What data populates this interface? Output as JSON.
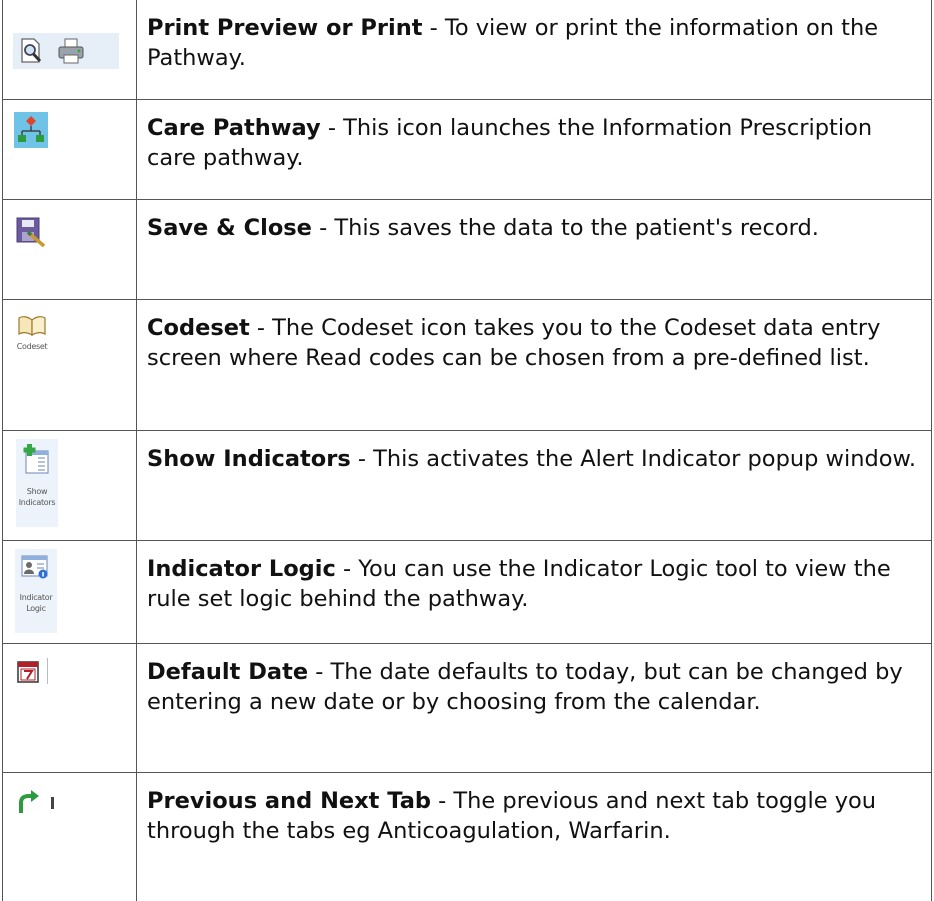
{
  "rows": [
    {
      "icon": [
        "print-preview-icon",
        "printer-icon"
      ],
      "title": "Print Preview or Print",
      "text": " - To view or print the information on the Pathway."
    },
    {
      "icon": [
        "care-pathway-icon"
      ],
      "title": "Care Pathway",
      "text": " - This icon launches the Information Prescription care pathway."
    },
    {
      "icon": [
        "save-close-icon"
      ],
      "title": "Save & Close",
      "text": " - This saves the data to the patient's record."
    },
    {
      "icon": [
        "codeset-icon"
      ],
      "icon_caption": "Codeset",
      "title": "Codeset",
      "text": " - The Codeset icon takes you to the Codeset data entry screen where Read codes can be chosen from a pre-defined list."
    },
    {
      "icon": [
        "show-indicators-icon"
      ],
      "icon_caption": [
        "Show",
        "Indicators"
      ],
      "title": "Show Indicators",
      "text": " - This activates the Alert Indicator popup window."
    },
    {
      "icon": [
        "indicator-logic-icon"
      ],
      "icon_caption": [
        "Indicator",
        "Logic"
      ],
      "title": "Indicator Logic",
      "text": " - You can use the Indicator Logic tool to view the rule set logic behind the pathway."
    },
    {
      "icon": [
        "calendar-icon"
      ],
      "title": "Default Date",
      "text": " - The date defaults to today, but can be changed by entering a new date or by choosing from the calendar."
    },
    {
      "icon": [
        "next-tab-arrow-icon"
      ],
      "title": "Previous and Next Tab",
      "text": " - The previous and next tab toggle you through the tabs eg Anticoagulation, Warfarin."
    }
  ]
}
